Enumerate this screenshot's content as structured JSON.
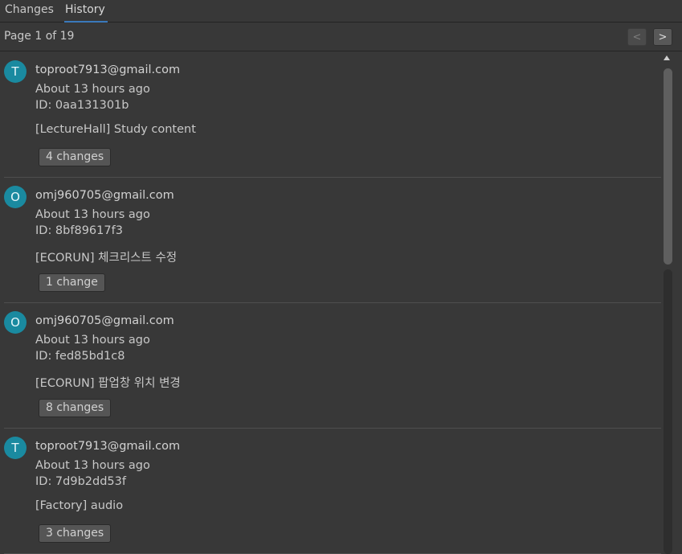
{
  "tabs": [
    {
      "label": "Changes",
      "active": false
    },
    {
      "label": "History",
      "active": true
    }
  ],
  "pager": {
    "label": "Page 1 of 19",
    "prev_label": "<",
    "next_label": ">"
  },
  "colors": {
    "accent": "#3a79bb",
    "avatar": "#1a8aa0",
    "background": "#383838"
  },
  "entries": [
    {
      "avatar": "T",
      "email": "toproot7913@gmail.com",
      "time": "About 13 hours ago",
      "id": "ID: 0aa131301b",
      "message": "[LectureHall] Study content",
      "changes": "4 changes"
    },
    {
      "avatar": "O",
      "email": "omj960705@gmail.com",
      "time": "About 13 hours ago",
      "id": "ID: 8bf89617f3",
      "message": "[ECORUN] 체크리스트 수정",
      "changes": "1 change"
    },
    {
      "avatar": "O",
      "email": "omj960705@gmail.com",
      "time": "About 13 hours ago",
      "id": "ID: fed85bd1c8",
      "message": "[ECORUN] 팝업창 위치 변경",
      "changes": "8 changes"
    },
    {
      "avatar": "T",
      "email": "toproot7913@gmail.com",
      "time": "About 13 hours ago",
      "id": "ID: 7d9b2dd53f",
      "message": "[Factory] audio",
      "changes": "3 changes"
    }
  ]
}
